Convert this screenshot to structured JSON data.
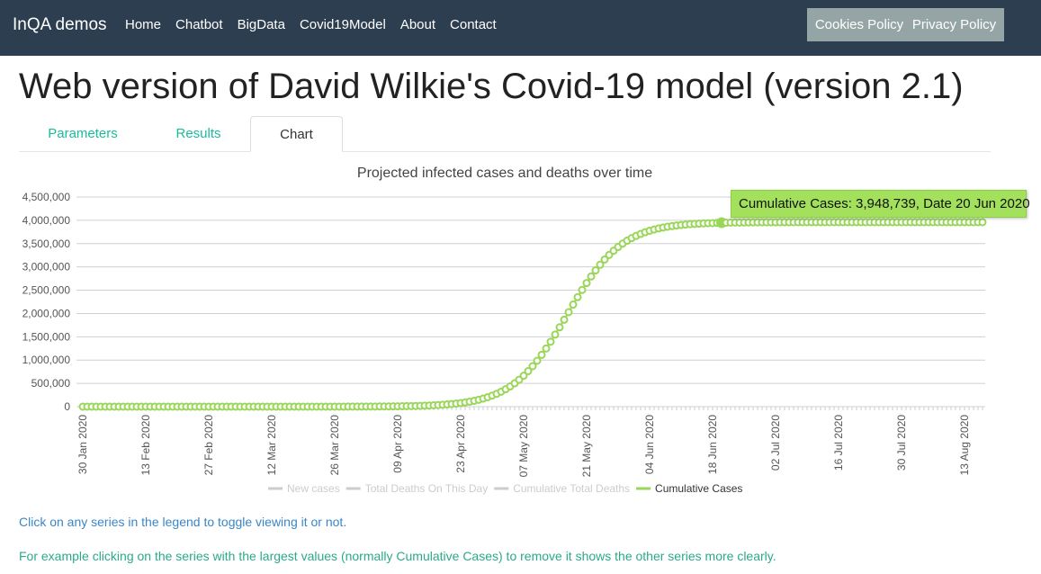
{
  "nav": {
    "brand": "InQA demos",
    "links": [
      "Home",
      "Chatbot",
      "BigData",
      "Covid19Model",
      "About",
      "Contact"
    ],
    "policy_links": [
      "Cookies Policy",
      "Privacy Policy"
    ]
  },
  "page_title": "Web version of David Wilkie's Covid-19 model (version 2.1)",
  "tabs": [
    {
      "label": "Parameters",
      "active": false
    },
    {
      "label": "Results",
      "active": false
    },
    {
      "label": "Chart",
      "active": true
    }
  ],
  "chart_data": {
    "type": "line",
    "title": "Projected infected cases and deaths over time",
    "xlabel": "",
    "ylabel": "",
    "ylim": [
      0,
      4500000
    ],
    "y_ticks": [
      "0",
      "500,000",
      "1,000,000",
      "1,500,000",
      "2,000,000",
      "2,500,000",
      "3,000,000",
      "3,500,000",
      "4,000,000",
      "4,500,000"
    ],
    "x_tick_labels": [
      "30 Jan 2020",
      "13 Feb 2020",
      "27 Feb 2020",
      "12 Mar 2020",
      "26 Mar 2020",
      "09 Apr 2020",
      "23 Apr 2020",
      "07 May 2020",
      "21 May 2020",
      "04 Jun 2020",
      "18 Jun 2020",
      "02 Jul 2020",
      "16 Jul 2020",
      "30 Jul 2020",
      "13 Aug 2020"
    ],
    "x_first": "30 Jan 2020",
    "x_step": "1 day",
    "grid": true,
    "legend_position": "bottom",
    "legend": [
      {
        "name": "New cases",
        "visible": false,
        "color": "#cccccc"
      },
      {
        "name": "Total Deaths On This Day",
        "visible": false,
        "color": "#cccccc"
      },
      {
        "name": "Cumulative Total Deaths",
        "visible": false,
        "color": "#cccccc"
      },
      {
        "name": "Cumulative Cases",
        "visible": true,
        "color": "#9ad65a"
      }
    ],
    "series": [
      {
        "name": "Cumulative Cases",
        "color": "#9ad65a",
        "values": [
          0,
          0,
          0,
          0,
          0,
          0,
          0,
          0,
          0,
          0,
          0,
          0,
          0,
          0,
          0,
          0,
          0,
          0,
          0,
          0,
          0,
          0,
          0,
          0,
          0,
          0,
          0,
          0,
          0,
          0,
          0,
          0,
          0,
          0,
          0,
          0,
          0,
          0,
          0,
          0,
          0,
          0,
          0,
          0,
          0,
          0,
          0,
          0,
          0,
          0,
          290,
          342,
          403,
          476,
          561,
          663,
          782,
          922,
          1087,
          1282,
          1512,
          1783,
          2102,
          2479,
          2923,
          3446,
          4064,
          4792,
          5650,
          6662,
          7855,
          9262,
          10920,
          12875,
          15180,
          17890,
          21080,
          24830,
          29300,
          34500,
          40600,
          47800,
          56200,
          66100,
          77800,
          91400,
          107300,
          126100,
          148000,
          173000,
          203000,
          237000,
          276000,
          322000,
          374000,
          434000,
          502000,
          578000,
          664000,
          762000,
          868000,
          985000,
          1112000,
          1249000,
          1394000,
          1547000,
          1704000,
          1866000,
          2029000,
          2191000,
          2351000,
          2506000,
          2654000,
          2795000,
          2925000,
          3046000,
          3158000,
          3257000,
          3347000,
          3428000,
          3500000,
          3563000,
          3618000,
          3666000,
          3708000,
          3744000,
          3776000,
          3803000,
          3826000,
          3845000,
          3863000,
          3877000,
          3890000,
          3900000,
          3909000,
          3917000,
          3923000,
          3929000,
          3934000,
          3938000,
          3941000,
          3944000,
          3948739,
          3949000,
          3951000,
          3952000,
          3953000,
          3954000,
          3955000,
          3956000,
          3957000,
          3957000,
          3958000,
          3958000,
          3958000,
          3959000,
          3959000,
          3959000,
          3960000,
          3960000,
          3960000,
          3960000,
          3960000,
          3960000,
          3960000,
          3960000,
          3960000,
          3960000,
          3960000,
          3960000,
          3960000,
          3960000,
          3960000,
          3960000,
          3960000,
          3960000,
          3960000,
          3960000,
          3960000,
          3960000,
          3960000,
          3960000,
          3960000,
          3960000,
          3960000,
          3960000,
          3960000,
          3960000,
          3960000,
          3960000,
          3960000,
          3960000,
          3960000,
          3960000,
          3960000,
          3960000,
          3960000,
          3960000,
          3960000,
          3960000,
          3960000
        ]
      }
    ],
    "highlighted_point": {
      "date": "20 Jun 2020",
      "value": 3948739
    },
    "tooltip": "Cumulative Cases: 3,948,739, Date 20 Jun 2020"
  },
  "notes": [
    "Click on any series in the legend to toggle viewing it or not.",
    "For example clicking on the series with the largest values (normally Cumulative Cases) to remove it shows the other series more clearly."
  ]
}
